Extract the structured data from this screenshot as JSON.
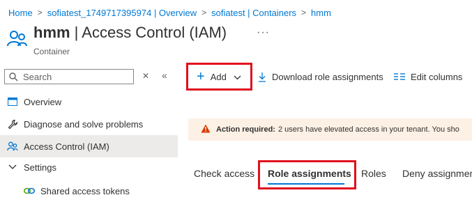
{
  "breadcrumb": [
    {
      "label": "Home"
    },
    {
      "label": "sofiatest_1749717395974 | Overview"
    },
    {
      "label": "sofiatest | Containers"
    },
    {
      "label": "hmm"
    }
  ],
  "header": {
    "title_bold": "hmm",
    "title_rest": " | Access Control (IAM)",
    "more": "···",
    "subtitle": "Container"
  },
  "search": {
    "placeholder": "Search",
    "value": ""
  },
  "sidebar": {
    "items": [
      {
        "label": "Overview",
        "icon": "overview-icon"
      },
      {
        "label": "Diagnose and solve problems",
        "icon": "wrench-icon"
      },
      {
        "label": "Access Control (IAM)",
        "icon": "people-icon",
        "active": true
      },
      {
        "label": "Settings",
        "icon": "chevron-down-icon"
      },
      {
        "label": "Shared access tokens",
        "icon": "link-icon"
      }
    ]
  },
  "toolbar": {
    "add_label": "Add",
    "download_label": "Download role assignments",
    "edit_columns_label": "Edit columns"
  },
  "banner": {
    "title": "Action required:",
    "text": "2 users have elevated access in your tenant. You sho"
  },
  "tabs": [
    {
      "label": "Check access"
    },
    {
      "label": "Role assignments",
      "active": true
    },
    {
      "label": "Roles"
    },
    {
      "label": "Deny assignmen"
    }
  ],
  "colors": {
    "accent": "#0078d4",
    "highlight_border": "#e0101e",
    "warning": "#d83b01",
    "banner_bg": "#fdf1e6"
  }
}
